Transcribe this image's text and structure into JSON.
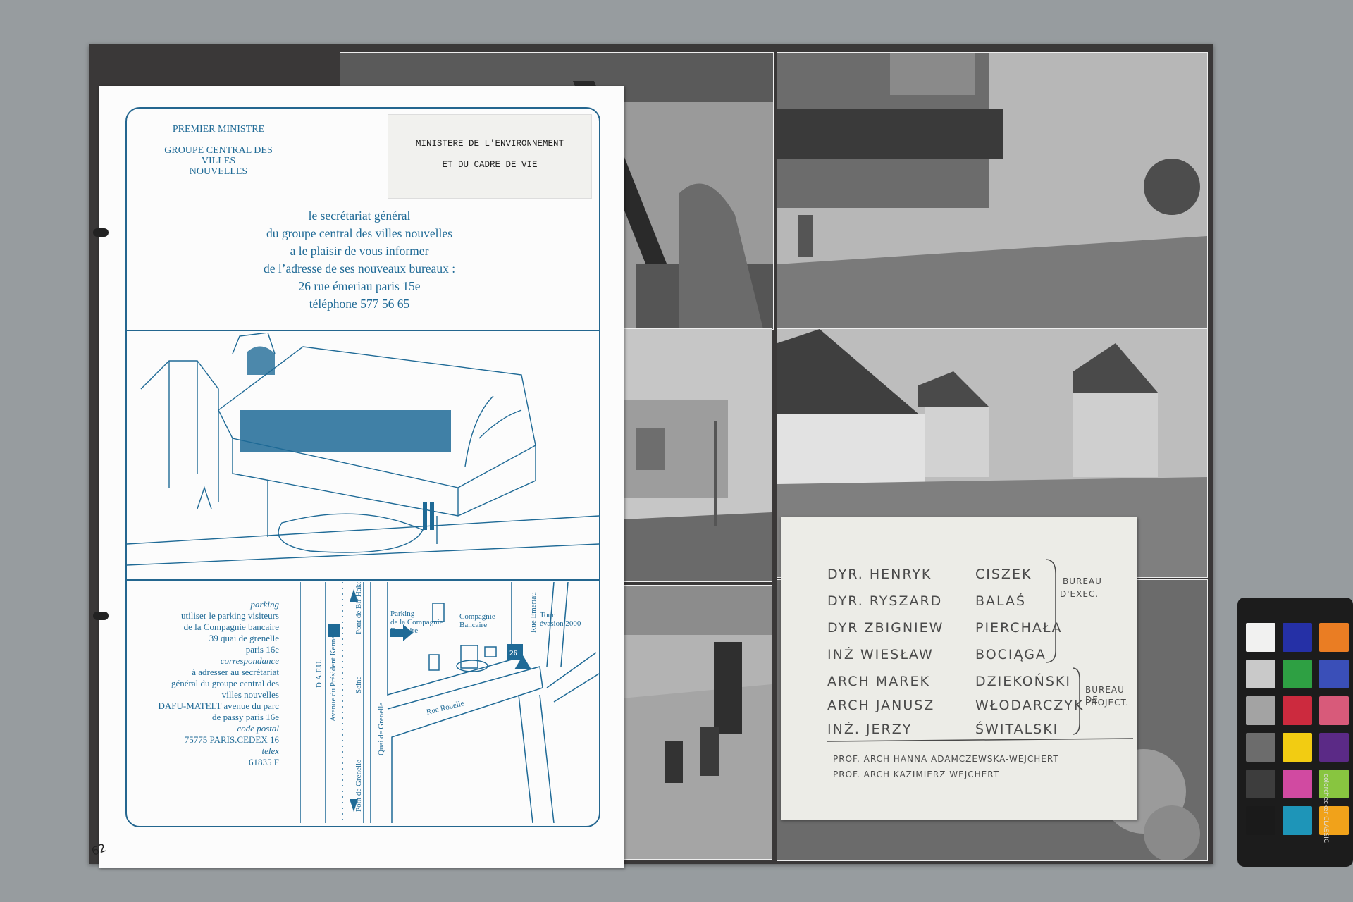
{
  "leaflet": {
    "header_line1": "PREMIER MINISTRE",
    "header_line2": "GROUPE CENTRAL DES VILLES",
    "header_line3": "NOUVELLES",
    "stamp_line1": "MINISTERE DE L'ENVIRONNEMENT",
    "stamp_line2": "ET DU CADRE DE VIE",
    "announce": [
      "le secrétariat général",
      "du groupe central des villes nouvelles",
      "a le plaisir de vous informer",
      "de l’adresse de ses nouveaux bureaux :",
      "26 rue émeriau paris 15e",
      "téléphone 577 56 65"
    ],
    "info": {
      "parking_label": "parking",
      "parking_text": [
        "utiliser le parking visiteurs",
        "de la Compagnie bancaire",
        "39 quai de grenelle",
        "paris 16e"
      ],
      "correspondance_label": "correspondance",
      "correspondance_text": [
        "à adresser au secrétariat",
        "général du groupe central des",
        "villes nouvelles"
      ],
      "dafu_text": [
        "DAFU-MATELT avenue du parc",
        "de passy paris 16e"
      ],
      "code_label": "code postal",
      "code_text": "75775 PARIS.CEDEX 16",
      "telex_label": "telex",
      "telex_text": "61835 F"
    },
    "map": {
      "dafu": "D.A.F.U.",
      "avenue": "Avenue du Président Kennedy",
      "seine": "Seine",
      "pont_bir": "Pont de Bir Hakeim",
      "pont_grenelle": "Pont de Grenelle",
      "quai": "Quai de Grenelle",
      "parking": [
        "Parking",
        "de la  Compagnie",
        "Bancaire"
      ],
      "compagnie": [
        "Compagnie",
        "Bancaire"
      ],
      "rue_emeriau": "Rue Emeriau",
      "tour": [
        "Tour",
        "évasion 2000"
      ],
      "rue_rouelle": "Rue Rouelle",
      "number": "26"
    }
  },
  "note": {
    "rows": [
      {
        "title": "DYR.",
        "first": "HENRYK",
        "last": "CISZEK"
      },
      {
        "title": "DYR.",
        "first": "RYSZARD",
        "last": "BALAŚ"
      },
      {
        "title": "DYR",
        "first": "ZBIGNIEW",
        "last": "PIERCHAŁA"
      },
      {
        "title": "INŻ",
        "first": "WIESŁAW",
        "last": "BOCIĄGA"
      },
      {
        "title": "ARCH",
        "first": "MAREK",
        "last": "DZIEKOŃSKI"
      },
      {
        "title": "ARCH",
        "first": "JANUSZ",
        "last": "WŁODARCZYK"
      },
      {
        "title": "INŻ.",
        "first": "JERZY",
        "last": "ŚWITALSKI"
      }
    ],
    "bracket1": [
      "BUREAU",
      "D'EXEC."
    ],
    "bracket2": [
      "BUREAU DE",
      "PROJECT."
    ],
    "prof1": "PROF. ARCH   HANNA ADAMCZEWSKA-WEJCHERT",
    "prof2": "PROF. ARCH   KAZIMIERZ WEJCHERT"
  },
  "page_number": "62",
  "colorchecker": {
    "brand": "colorchecker CLASSIC",
    "patches": [
      "#f1f1f0",
      "#2530a6",
      "#ea7d23",
      "#c9c9c9",
      "#2ea043",
      "#3a4fb8",
      "#a3a3a3",
      "#cc2a3e",
      "#d85a7a",
      "#6c6c6c",
      "#f2cc12",
      "#5b2a86",
      "#3d3d3d",
      "#d14aa1",
      "#88c540",
      "#1a1a1a",
      "#1e95b8",
      "#f1a21a"
    ]
  }
}
